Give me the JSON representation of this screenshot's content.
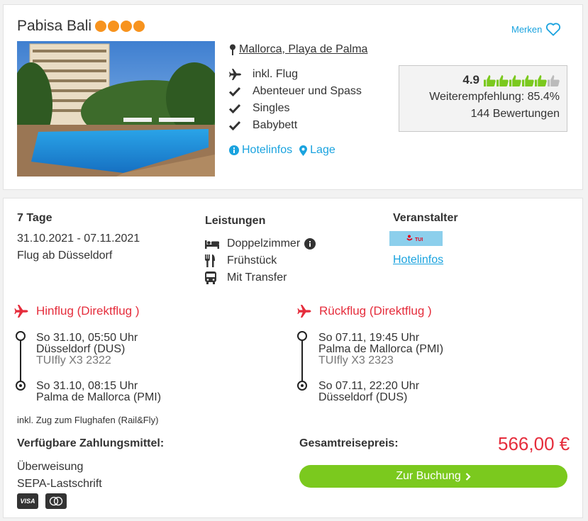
{
  "hotel": {
    "name": "Pabisa Bali",
    "stars": 4,
    "merken_label": "Merken",
    "location": "Mallorca, Playa de Palma",
    "features": [
      "inkl. Flug",
      "Abenteuer und Spass",
      "Singles",
      "Babybett"
    ],
    "hotelinfos_label": "Hotelinfos",
    "lage_label": "Lage"
  },
  "rating": {
    "score": "4.9",
    "thumbs_filled": 5,
    "thumbs_total": 6,
    "recommendation": "Weiterempfehlung: 85.4%",
    "reviews": "144 Bewertungen"
  },
  "trip": {
    "duration": "7 Tage",
    "dates": "31.10.2021 - 07.11.2021",
    "departure": "Flug ab Düsseldorf"
  },
  "leistungen": {
    "heading": "Leistungen",
    "items": [
      "Doppelzimmer",
      "Frühstück",
      "Mit Transfer"
    ]
  },
  "veranstalter": {
    "heading": "Veranstalter",
    "logo_text": "TUI",
    "hotelinfos_label": "Hotelinfos"
  },
  "hinflug": {
    "heading": "Hinflug (Direktflug )",
    "dep_time": "So 31.10, 05:50 Uhr",
    "dep_airport": "Düsseldorf (DUS)",
    "flight": "TUIfly X3 2322",
    "arr_time": "So 31.10, 08:15 Uhr",
    "arr_airport": "Palma de Mallorca (PMI)"
  },
  "rueckflug": {
    "heading": "Rückflug (Direktflug )",
    "dep_time": "So 07.11, 19:45 Uhr",
    "dep_airport": "Palma de Mallorca (PMI)",
    "flight": "TUIfly X3 2323",
    "arr_time": "So 07.11, 22:20 Uhr",
    "arr_airport": "Düsseldorf (DUS)"
  },
  "rail_note": "inkl. Zug zum Flughafen (Rail&Fly)",
  "payment": {
    "heading": "Verfügbare Zahlungsmittel:",
    "methods": [
      "Überweisung",
      "SEPA-Lastschrift"
    ],
    "cards": [
      "VISA",
      "mastercard"
    ]
  },
  "price": {
    "label": "Gesamtreisepreis:",
    "value": "566,00 €"
  },
  "booking": {
    "button_label": "Zur Buchung"
  },
  "colors": {
    "accent_blue": "#1aa3df",
    "star_orange": "#f7931e",
    "flight_red": "#e52d3c",
    "button_green": "#7bc91e",
    "thumb_green": "#7bc91e"
  }
}
